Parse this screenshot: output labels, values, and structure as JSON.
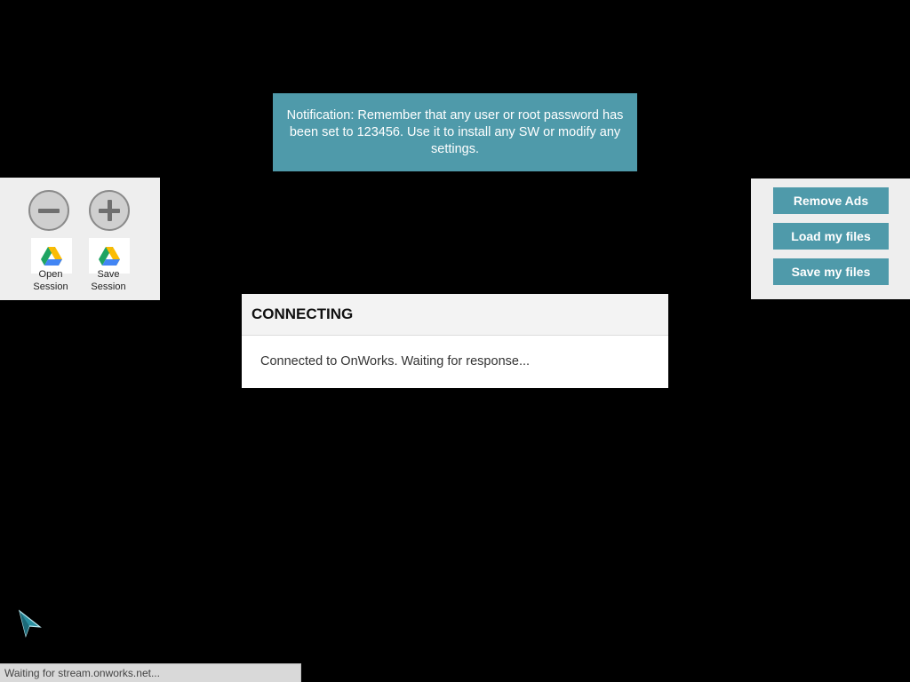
{
  "notification": {
    "text": "Notification: Remember that any user or root password has been set to 123456. Use it to install any SW or modify any settings."
  },
  "left_panel": {
    "zoom_out_icon": "minus-icon",
    "zoom_in_icon": "plus-icon",
    "open_session_label_line1": "Open",
    "open_session_label_line2": "Session",
    "save_session_label_line1": "Save",
    "save_session_label_line2": "Session",
    "drive_icon": "google-drive-icon"
  },
  "right_panel": {
    "remove_ads": "Remove Ads",
    "load_files": "Load my files",
    "save_files": "Save my files"
  },
  "dialog": {
    "title": "CONNECTING",
    "message": "Connected to OnWorks. Waiting for response..."
  },
  "status": {
    "text": "Waiting for stream.onworks.net..."
  },
  "colors": {
    "accent": "#4f9aaa",
    "background": "#000000",
    "panel": "#eeeeee"
  }
}
